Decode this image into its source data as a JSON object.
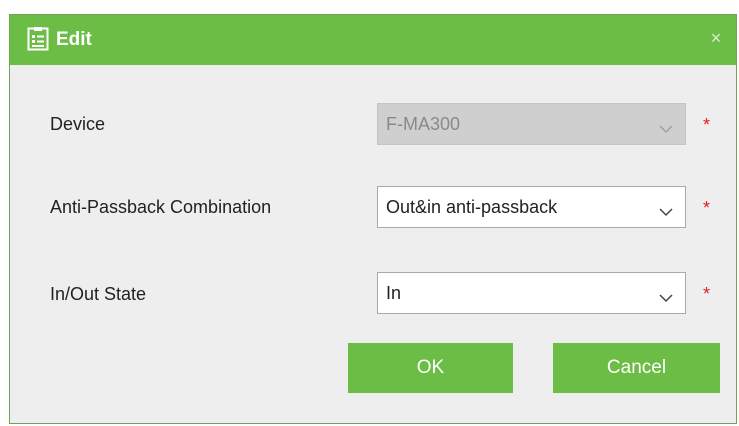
{
  "dialog": {
    "title": "Edit",
    "icon": "edit-form-icon",
    "close_symbol": "×",
    "accent_color": "#6cbd45"
  },
  "form": {
    "device": {
      "label": "Device",
      "value": "F-MA300",
      "disabled": true,
      "required": "*"
    },
    "combination": {
      "label": "Anti-Passback Combination",
      "value": "Out&in anti-passback",
      "required": "*"
    },
    "state": {
      "label": "In/Out State",
      "value": "In",
      "required": "*"
    }
  },
  "buttons": {
    "ok": "OK",
    "cancel": "Cancel"
  }
}
